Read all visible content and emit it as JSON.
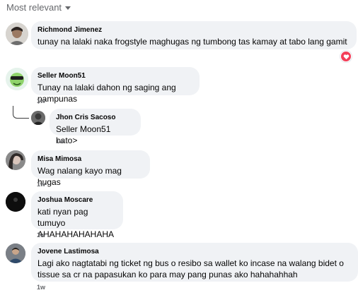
{
  "sort": {
    "label": "Most relevant"
  },
  "comments": [
    {
      "name": "Richmond Jimenez",
      "text": "tunay na lalaki naka frogstyle maghugas ng tumbong tas kamay at tabo lang gamit",
      "time": ""
    },
    {
      "name": "Seller Moon51",
      "text": "Tunay na lalaki dahon ng saging ang pampunas",
      "time": "1w"
    },
    {
      "name": "Jhon Cris Sacoso",
      "text": "Seller Moon51 bato>",
      "time": "1w"
    },
    {
      "name": "Misa Mimosa",
      "text": "Wag nalang kayo mag hugas",
      "time": "1w"
    },
    {
      "name": "Joshua Moscare",
      "text_lines": [
        "kati nyan pag tumuyo",
        "AHAHAHAHAHAHA"
      ],
      "time": "1w"
    },
    {
      "name": "Jovene Lastimosa",
      "text_lines": [
        "Lagi ako nagtatabi ng ticket ng bus o resibo sa wallet ko incase na walang bidet o",
        "tissue sa cr na papasukan ko para may pang punas ako hahahahhah"
      ],
      "time": "1w"
    }
  ],
  "reaction": {
    "icon": "heart-icon",
    "color": "#f33e58"
  }
}
